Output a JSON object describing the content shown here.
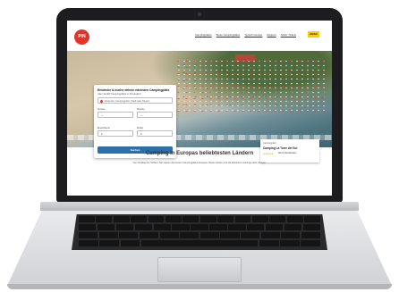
{
  "brand": {
    "logo_text": "PiN"
  },
  "nav": {
    "links": [
      "Campingplätze",
      "Beste Campingplätze",
      "Typisch Camper",
      "Regions",
      "ADAC Tickets"
    ],
    "partner_badge": "ADAC"
  },
  "search": {
    "title": "Entdecke & buche deinen nächsten Campingplatz",
    "subtitle": "Über 10.000 Campingplätze in 40 Ländern",
    "location_placeholder": "Reiseziel, Campingplatz, Stadt oder Region",
    "arrival_label": "Anreise",
    "arrival_value": "—",
    "departure_label": "Abreise",
    "departure_value": "—",
    "adults_label": "Erwachsene",
    "adults_value": "2",
    "children_label": "Kinder",
    "children_value": "0",
    "submit_label": "Suchen"
  },
  "featured": {
    "kicker": "Campingplatz",
    "name": "Camping La Torre del Sol",
    "rating": "★★★★★",
    "classification": "ADAC Klassifikation"
  },
  "section": {
    "title": "Camping in Europas beliebtesten Ländern",
    "text": "Von Nordkap bis Sizilien: hier warten die besten Campingplätze Europas. Diese Länder sind die absoluten Lieblinge aller Camper."
  },
  "colors": {
    "brand_red": "#e63329",
    "button_blue": "#2d6fa8",
    "adac_yellow": "#ffcc00"
  }
}
